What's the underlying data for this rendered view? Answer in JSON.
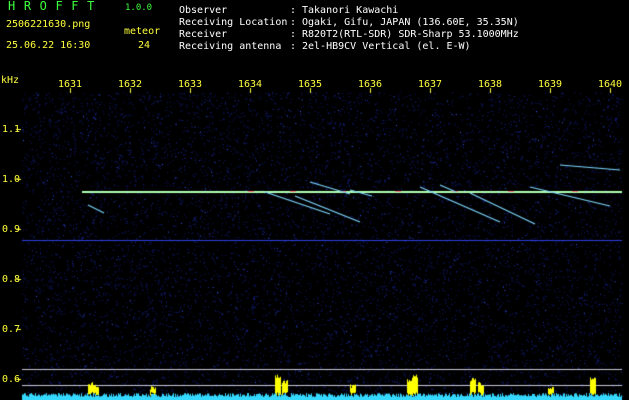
{
  "header": {
    "app_title": "HROFFT",
    "app_version": "1.0.0",
    "file_name": "2506221630.png",
    "meteor_label": "meteor",
    "date_time": "25.06.22 16:30",
    "meteor_count": "24"
  },
  "station_info": [
    {
      "key": "Observer",
      "value": "Takanori Kawachi"
    },
    {
      "key": "Receiving Location",
      "value": "Ogaki, Gifu, JAPAN (136.60E, 35.35N)"
    },
    {
      "key": "Receiver",
      "value": "R820T2(RTL-SDR) SDR-Sharp 53.1000MHz"
    },
    {
      "key": "Receiving antenna",
      "value": "2el-HB9CV Vertical (el. E-W)"
    }
  ],
  "separator": ":",
  "axis": {
    "y_unit": "kHz",
    "x_ticks": [
      "1631",
      "1632",
      "1633",
      "1634",
      "1635",
      "1636",
      "1637",
      "1638",
      "1639",
      "1640"
    ],
    "y_ticks": [
      "1.1",
      "1.0",
      "0.9",
      "0.8",
      "0.7",
      "0.6"
    ]
  },
  "colors": {
    "title": "#3cff3c",
    "labels": "#ffff3c",
    "info_text": "#ffffff",
    "background": "#000000",
    "noise": "#1a2ab0",
    "carrier": "#b0ffb0",
    "meteor": "#7fd8ff",
    "baseline": "#35d8ff",
    "activity": "#ffff00"
  }
}
